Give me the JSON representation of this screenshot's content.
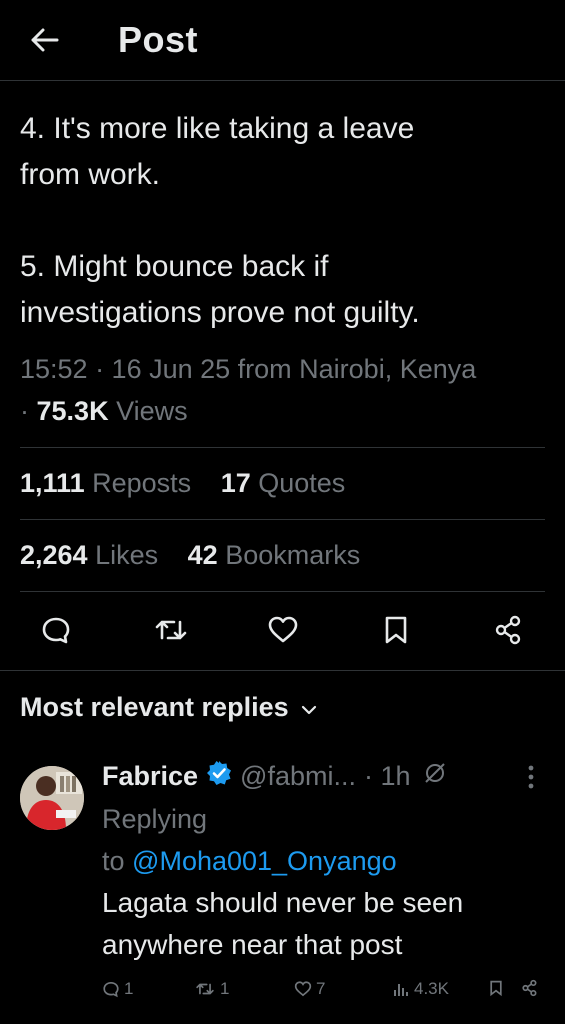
{
  "header": {
    "title": "Post"
  },
  "tweet": {
    "line1": "4. It's more like taking a leave",
    "line2": "from work.",
    "line3": "5. Might bounce back if",
    "line4": "investigations prove not guilty.",
    "meta_time": "15:52 · 16 Jun 25 from Nairobi, Kenya",
    "views_prefix": "·",
    "views_count": "75.3K",
    "views_label": "Views"
  },
  "stats": {
    "reposts_count": "1,111",
    "reposts_label": "Reposts",
    "quotes_count": "17",
    "quotes_label": "Quotes",
    "likes_count": "2,264",
    "likes_label": "Likes",
    "bookmarks_count": "42",
    "bookmarks_label": "Bookmarks"
  },
  "actions": [
    "reply-icon",
    "repost-icon",
    "like-icon",
    "bookmark-icon",
    "share-icon"
  ],
  "replies": {
    "heading": "Most relevant replies",
    "items": [
      {
        "name": "Fabrice",
        "handle": "@fabmi...",
        "time": "· 1h",
        "replying_label": "Replying",
        "to_label": "to",
        "mention": "@Moha001_Onyango",
        "text_line1": "Lagata should never be seen",
        "text_line2": "anywhere near that post",
        "reply_count": "1",
        "repost_count": "1",
        "like_count": "7",
        "view_count": "4.3K"
      }
    ]
  },
  "colors": {
    "background": "#000000",
    "text": "#e7e9ea",
    "muted": "#71767b",
    "link": "#1d9bf0",
    "divider": "#2f3336",
    "verified": "#1d9bf0"
  }
}
